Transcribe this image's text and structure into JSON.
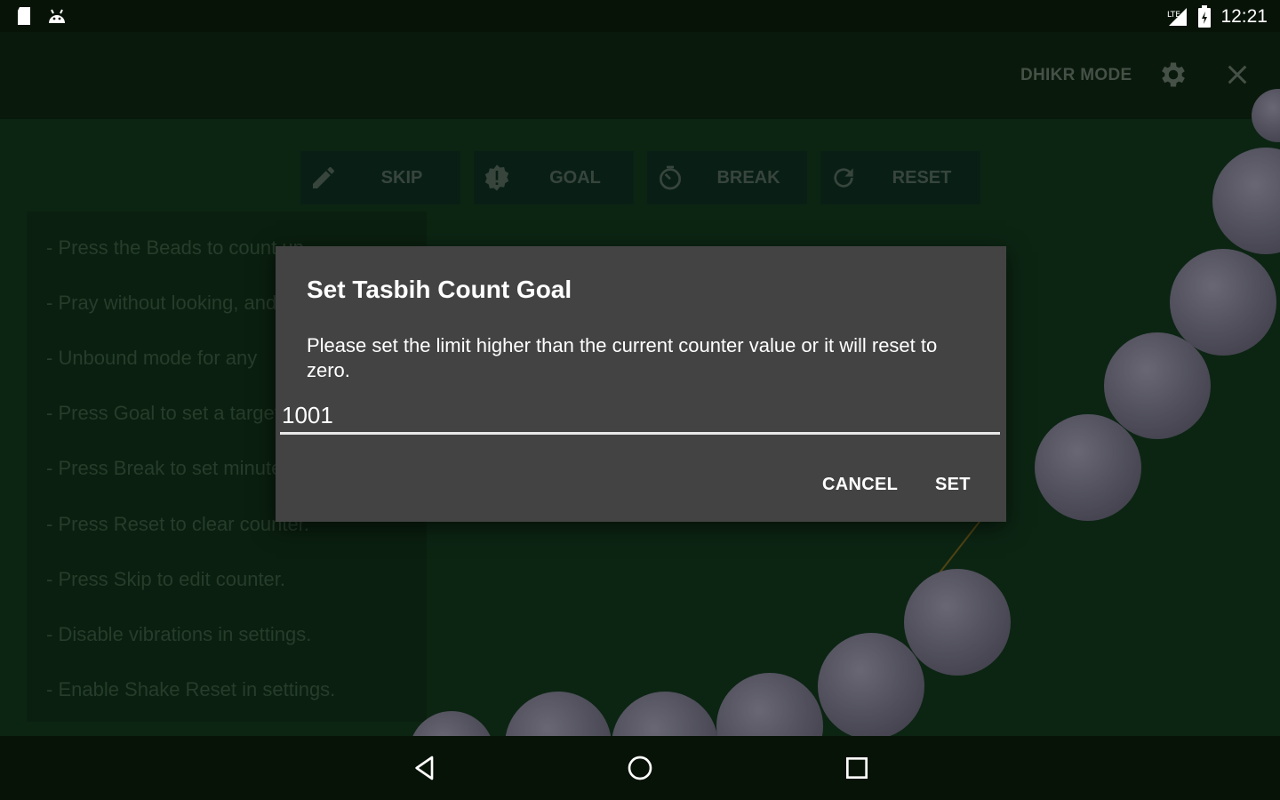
{
  "status_bar": {
    "time": "12:21",
    "left_icons": [
      "sd-card-icon",
      "android-icon"
    ],
    "right_icons": [
      "signal-icon",
      "battery-icon"
    ]
  },
  "action_bar": {
    "mode_label": "DHIKR MODE",
    "settings_icon": "gear-icon",
    "close_icon": "close-icon"
  },
  "toolbar": {
    "buttons": [
      {
        "label": "SKIP",
        "icon": "pencil-icon"
      },
      {
        "label": "GOAL",
        "icon": "badge-alert-icon"
      },
      {
        "label": "BREAK",
        "icon": "timer-icon"
      },
      {
        "label": "RESET",
        "icon": "refresh-icon"
      }
    ]
  },
  "hints": [
    "- Press the Beads to count up.",
    "- Pray without looking, and",
    "- Unbound mode for any",
    "- Press Goal to set a target",
    "- Press Break to set minutes",
    "- Press Reset to clear counter.",
    "- Press Skip to edit counter.",
    "- Disable vibrations in settings.",
    "- Enable Shake Reset in settings."
  ],
  "dialog": {
    "title": "Set Tasbih Count Goal",
    "message": "Please set the limit higher than the current counter value or it will reset to zero.",
    "input_value": "1001",
    "cancel_label": "CANCEL",
    "set_label": "SET"
  },
  "nav_bar": {
    "icons": [
      "back-icon",
      "home-icon",
      "recents-icon"
    ]
  },
  "colors": {
    "background": "#10321a",
    "dialog": "#434343",
    "bead": "#6f6d7e",
    "toolbar_button": "#0d2a1e"
  }
}
